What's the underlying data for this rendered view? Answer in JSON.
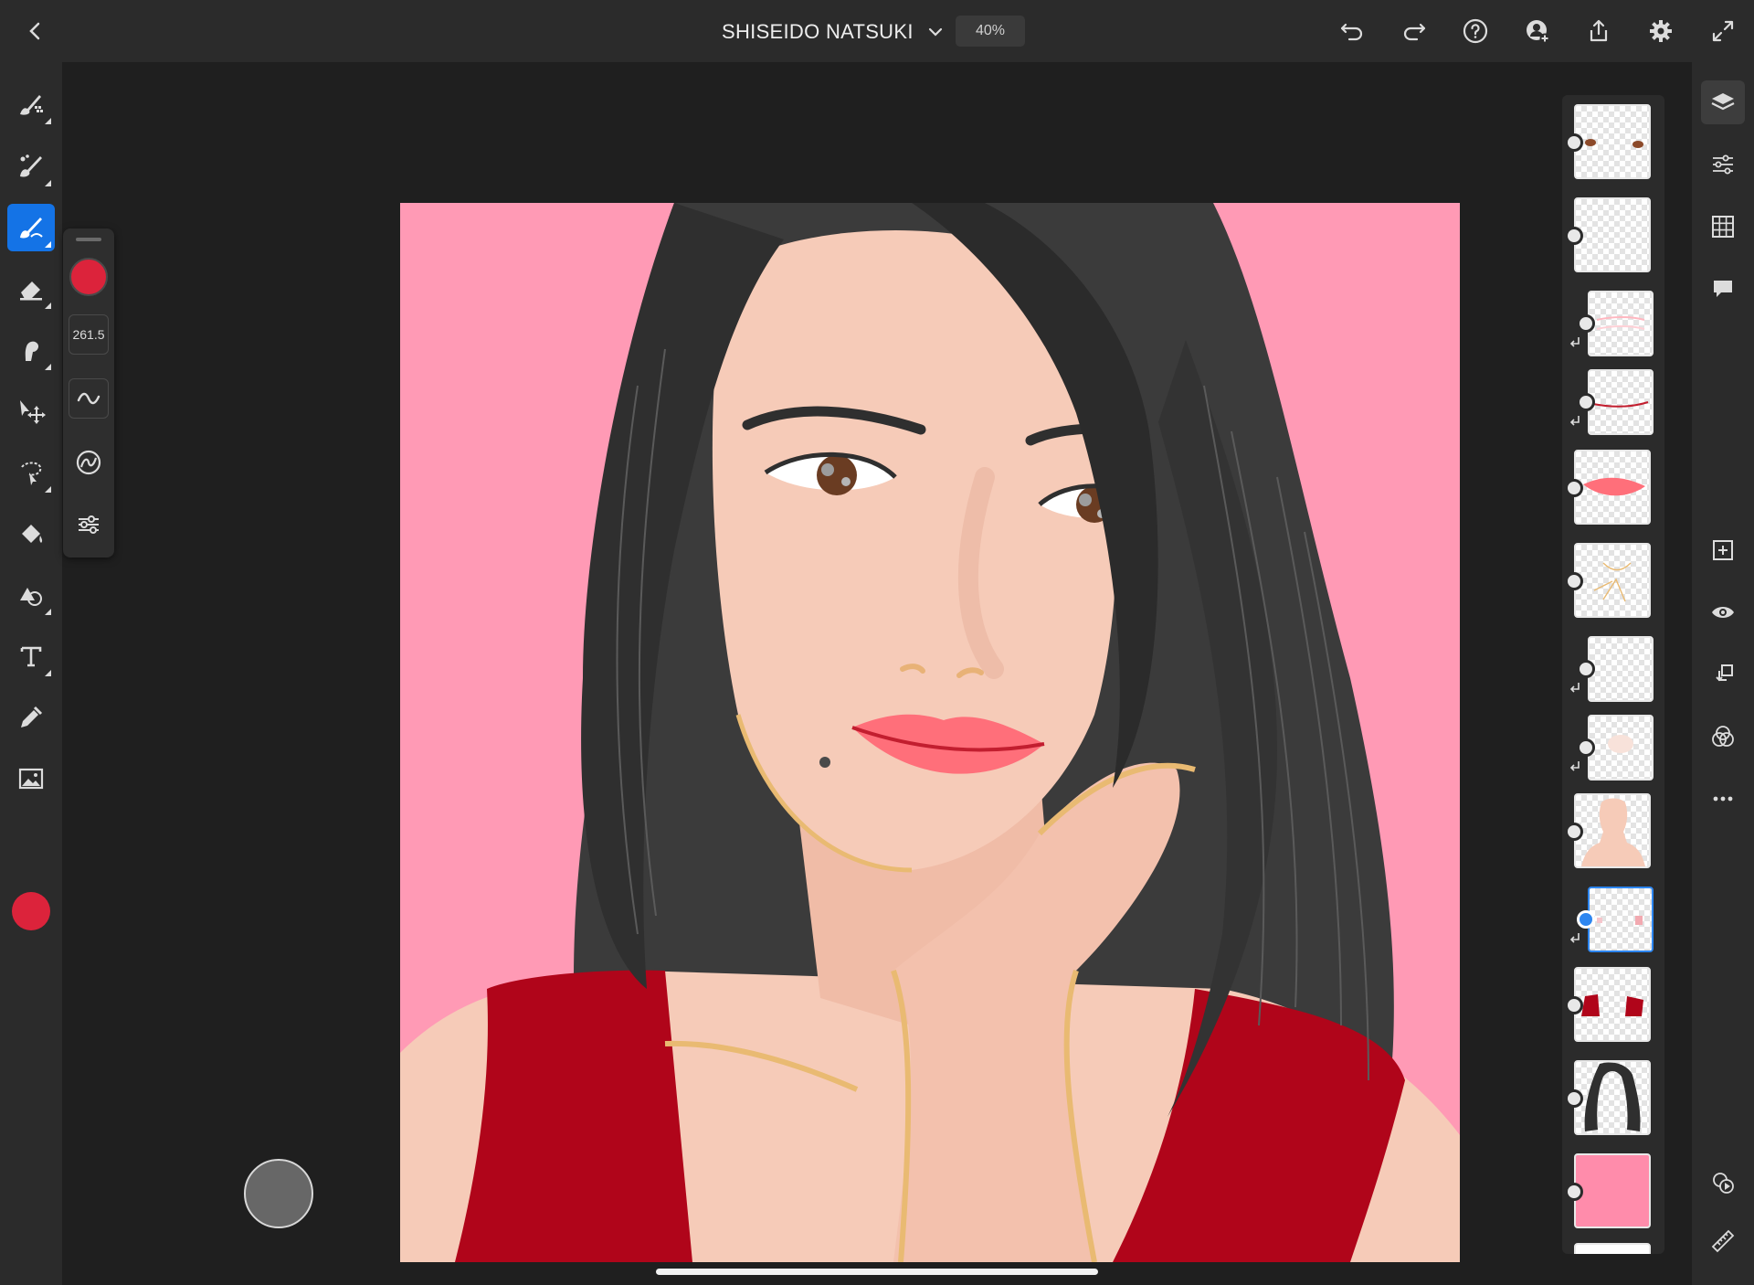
{
  "header": {
    "title": "SHISEIDO NATSUKI",
    "zoom": "40%",
    "icons": [
      "back-icon",
      "chevron-down-icon",
      "undo-icon",
      "redo-icon",
      "help-icon",
      "invite-icon",
      "share-icon",
      "settings-icon",
      "fullscreen-icon"
    ]
  },
  "left_toolbar": {
    "tools": [
      "pixel-brush-icon",
      "live-brush-icon",
      "vector-brush-icon",
      "eraser-icon",
      "smudge-icon",
      "transform-icon",
      "selection-icon",
      "fill-icon",
      "shape-icon",
      "text-icon",
      "eyedropper-icon",
      "image-icon"
    ],
    "active_tool": "vector-brush-icon",
    "color": "#dc233b"
  },
  "brush_panel": {
    "color": "#dc233b",
    "size": "261.5",
    "icons": [
      "smoothing-icon",
      "taper-icon",
      "brush-settings-icon"
    ]
  },
  "layers": {
    "selected_index": 9,
    "count_visible": 13
  },
  "right_toolbar": {
    "icons": [
      "layers-icon",
      "properties-icon",
      "grid-icon",
      "comments-icon",
      "add-layer-icon",
      "visibility-icon",
      "move-layer-icon",
      "blend-icon",
      "more-icon",
      "timelapse-icon",
      "ruler-icon"
    ]
  },
  "colors": {
    "accent": "#1473e6",
    "background_pink": "#ff9ab5",
    "dress_red": "#b0051a",
    "skin": "#f6cbb8",
    "hair": "#3a3a3a"
  }
}
